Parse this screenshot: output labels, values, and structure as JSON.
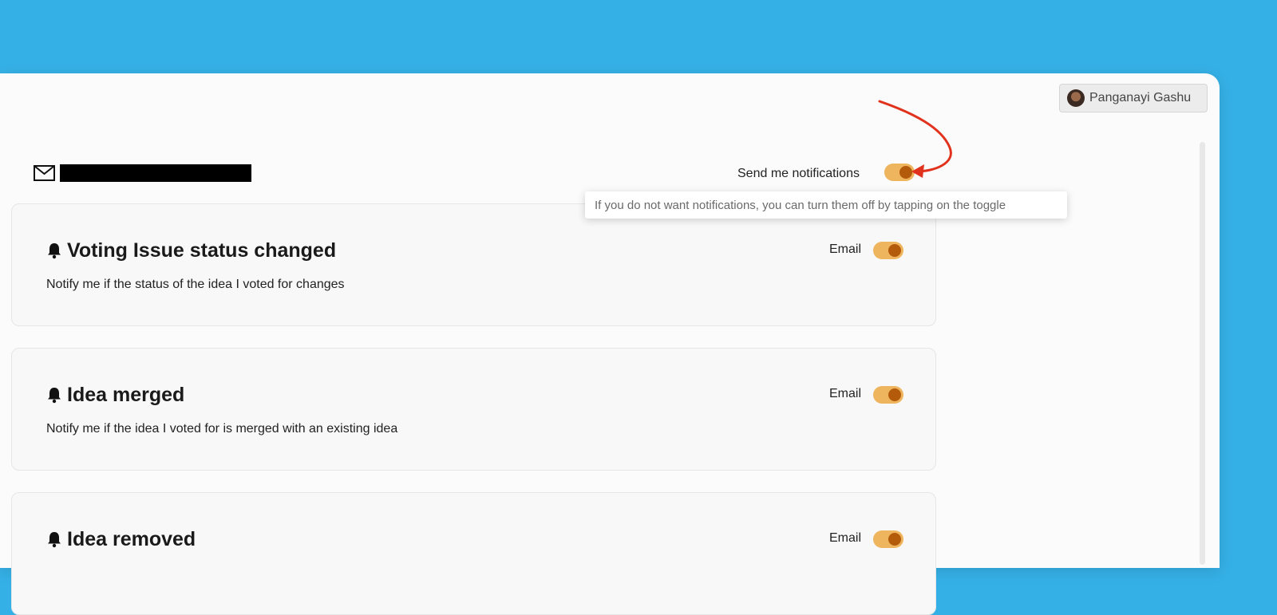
{
  "user": {
    "name": "Panganayi Gashu"
  },
  "header": {
    "mail_icon": "mail-icon",
    "notifications_label": "Send me notifications",
    "notifications_enabled": true
  },
  "tooltip": {
    "text": "If you do not want notifications, you can turn them off by tapping on the toggle"
  },
  "cards": [
    {
      "title": "Voting Issue status changed",
      "description": "Notify me if the status of the idea I voted for changes",
      "channel": "Email",
      "enabled": true
    },
    {
      "title": "Idea merged",
      "description": "Notify me if the idea I voted for is merged with an existing idea",
      "channel": "Email",
      "enabled": true
    },
    {
      "title": "Idea removed",
      "description": "",
      "channel": "Email",
      "enabled": true
    }
  ],
  "colors": {
    "background": "#35b0e6",
    "toggle_track": "#efb55e",
    "toggle_knob": "#b35b0b",
    "annotation_arrow": "#e0321c"
  }
}
